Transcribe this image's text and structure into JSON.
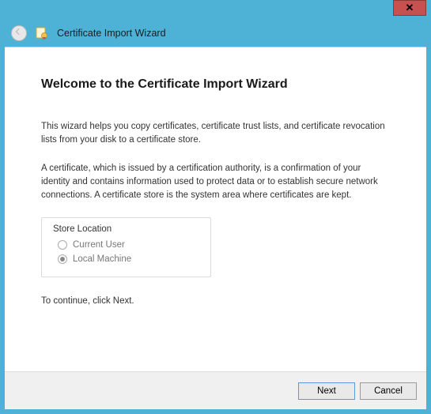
{
  "window": {
    "title": "Certificate Import Wizard",
    "close_glyph": "✕"
  },
  "page": {
    "heading": "Welcome to the Certificate Import Wizard",
    "intro": "This wizard helps you copy certificates, certificate trust lists, and certificate revocation lists from your disk to a certificate store.",
    "explanation": "A certificate, which is issued by a certification authority, is a confirmation of your identity and contains information used to protect data or to establish secure network connections. A certificate store is the system area where certificates are kept.",
    "continue": "To continue, click Next."
  },
  "store_location": {
    "group_label": "Store Location",
    "options": {
      "current_user": "Current User",
      "local_machine": "Local Machine"
    },
    "selected": "local_machine",
    "disabled": true
  },
  "footer": {
    "next": "Next",
    "cancel": "Cancel"
  }
}
